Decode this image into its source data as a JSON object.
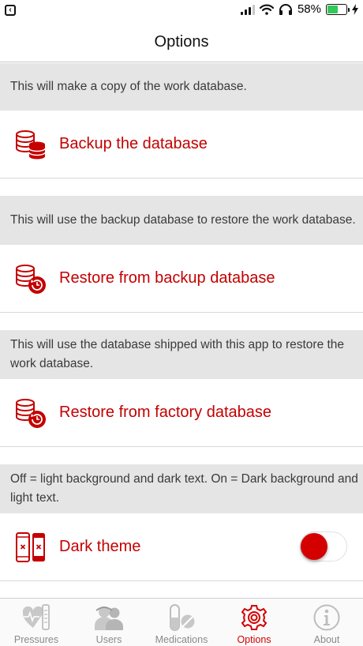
{
  "status": {
    "battery_percent": "58%",
    "battery_level": 0.58,
    "icons": [
      "back-to-app-icon",
      "signal-icon",
      "wifi-icon",
      "headphones-icon",
      "battery-icon",
      "charging-icon"
    ]
  },
  "nav": {
    "title": "Options"
  },
  "sections": [
    {
      "header": "This will make a copy of the work database.",
      "label": "Backup the database",
      "icon": "database-backup-icon"
    },
    {
      "header": "This will use the backup database to restore the work database.",
      "label": "Restore from backup database",
      "icon": "database-restore-icon"
    },
    {
      "header": "This will use the database shipped with this app to restore the work database.",
      "label": "Restore from factory database",
      "icon": "database-factory-restore-icon"
    },
    {
      "header": "Off = light background and dark text. On = Dark background and light text.",
      "label": "Dark theme",
      "icon": "phones-theme-icon",
      "toggle_on": true
    }
  ],
  "tabs": [
    {
      "label": "Pressures",
      "icon": "heart-pressure-icon",
      "active": false
    },
    {
      "label": "Users",
      "icon": "users-icon",
      "active": false
    },
    {
      "label": "Medications",
      "icon": "pills-icon",
      "active": false
    },
    {
      "label": "Options",
      "icon": "gear-icon",
      "active": true
    },
    {
      "label": "About",
      "icon": "info-icon",
      "active": false
    }
  ],
  "colors": {
    "accent": "#d40000",
    "header_bg": "#e5e5e5",
    "inactive_tab": "#8a8a8a"
  }
}
